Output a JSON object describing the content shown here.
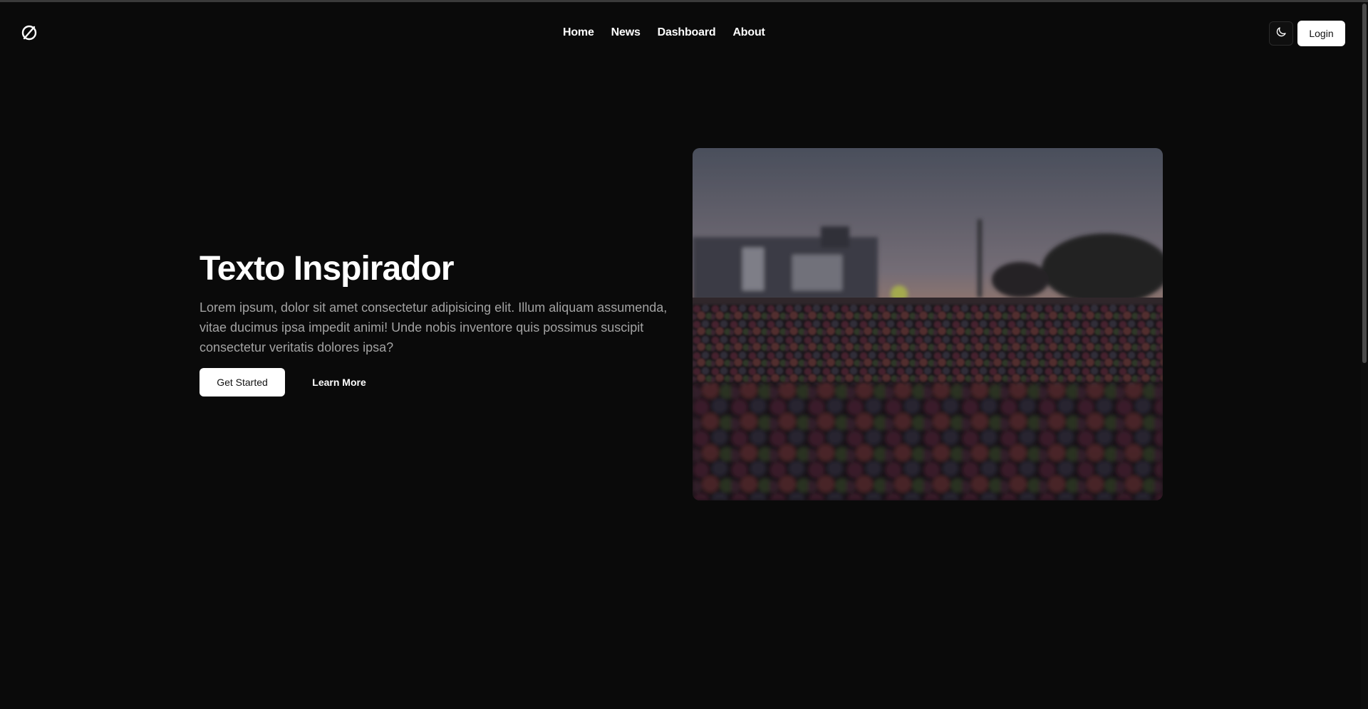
{
  "nav": {
    "logo_icon": "leaf-slash-icon",
    "links": [
      "Home",
      "News",
      "Dashboard",
      "About"
    ],
    "theme_icon": "moon-icon",
    "login_label": "Login"
  },
  "hero": {
    "title": "Texto Inspirador",
    "text": "Lorem ipsum, dolor sit amet consectetur adipisicing elit. Illum aliquam assumenda, vitae ducimus ipsa impedit animi! Unde nobis inventore quis possimus suscipit consectetur veritatis dolores ipsa?",
    "primary_cta": "Get Started",
    "secondary_cta": "Learn More",
    "image": "coffee-beans-sunset-photo"
  },
  "colors": {
    "background": "#0a0a0a",
    "text": "#ffffff",
    "muted_text": "#a3a3a3",
    "button_bg": "#ffffff",
    "button_text": "#111111"
  }
}
